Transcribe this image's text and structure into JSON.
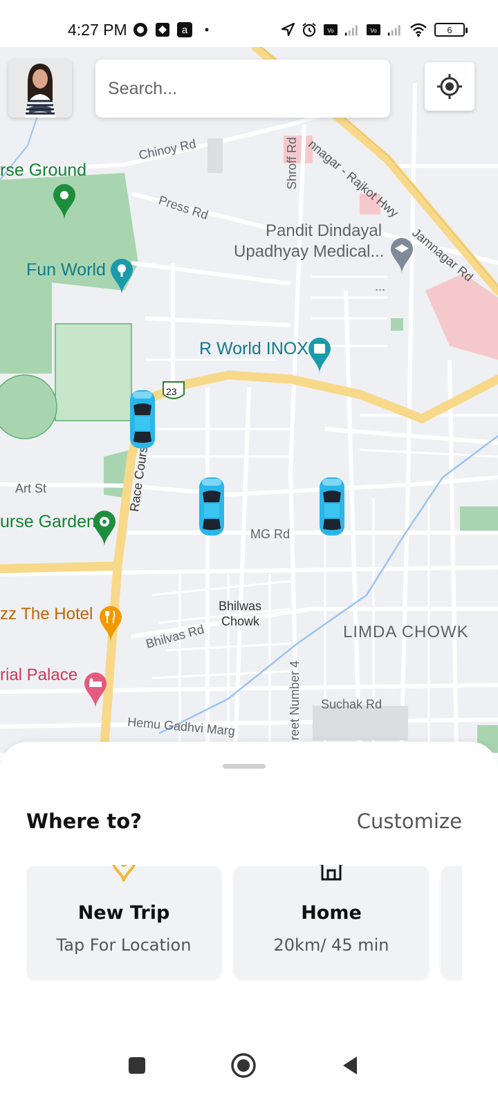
{
  "status_bar": {
    "time": "4:27 PM",
    "battery_level": "6",
    "icons": [
      "camera-o-icon",
      "sync-icon",
      "amazon-icon",
      "dot-icon",
      "location-arrow-icon",
      "alarm-icon",
      "volte-icon",
      "signal-icon",
      "volte-icon",
      "signal-icon",
      "wifi-icon",
      "battery-icon"
    ]
  },
  "search": {
    "placeholder": "Search..."
  },
  "map": {
    "labels": {
      "race_ground": "rse Ground",
      "chinoy_rd": "Chinoy Rd",
      "press_rd": "Press Rd",
      "shroff_rd": "Shroff Rd",
      "hwy": "nnagar - Rajkot Hwy",
      "jamnagar_rd": "Jamnagar Rd",
      "medical_1": "Pandit Dindayal",
      "medical_2": "Upadhyay Medical...",
      "fun_world": "Fun World",
      "r_world": "R World INOX",
      "route_23": "23",
      "art_st": "Art St",
      "race_course": "Race Cours",
      "garden": "urse Garden",
      "mg_rd": "MG Rd",
      "hotel": "zz The Hotel",
      "bhilwas_chowk_1": "Bhilwas",
      "bhilwas_chowk_2": "Chowk",
      "bhilvas_rd": "Bhilvas Rd",
      "limda": "LIMDA CHOWK",
      "palace": "rial Palace",
      "street4": "reet Number 4",
      "suchak": "Suchak Rd",
      "hemu": "Hemu Gadhvi Marg",
      "ellipsis": "..."
    },
    "vehicles": 3
  },
  "sheet": {
    "title": "Where to?",
    "customize": "Customize",
    "cards": [
      {
        "title": "New Trip",
        "subtitle": "Tap For Location",
        "icon": "location-pin-icon"
      },
      {
        "title": "Home",
        "subtitle": "20km/ 45 min",
        "icon": "home-icon"
      }
    ]
  },
  "colors": {
    "accent": "#f2b838",
    "car": "#29b6e8",
    "road_major": "#f8d98a",
    "park": "#a8d5b0"
  }
}
